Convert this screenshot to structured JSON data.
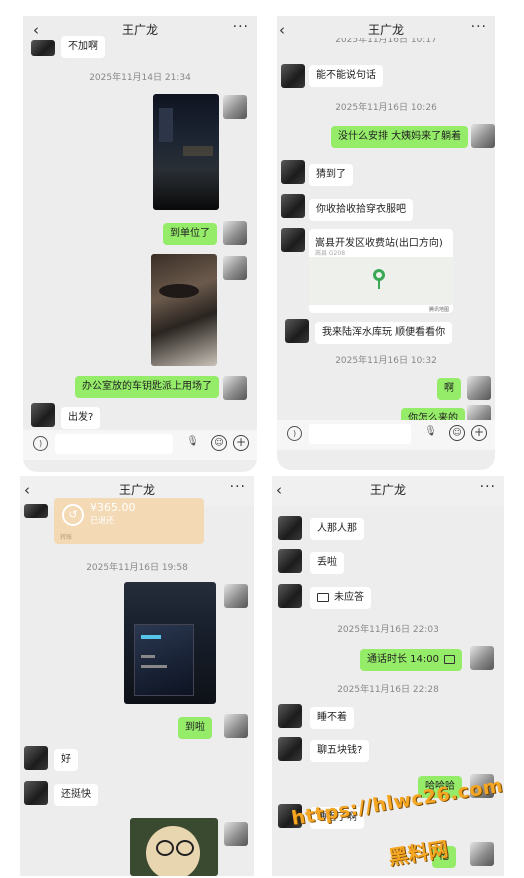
{
  "panel1": {
    "title": "王广龙",
    "back": "‹",
    "more": "···",
    "top_partial_msg": "不加啊",
    "timestamp1": "2025年11月14日 21:34",
    "msg_arrived": "到单位了",
    "msg_keys": "办公室放的车钥匙派上用场了",
    "msg_depart": "出发?"
  },
  "panel2": {
    "title": "王广龙",
    "back": "‹",
    "more": "···",
    "top_partial_ts": "2025年11月16日 10:17",
    "msg_talk": "能不能说句话",
    "timestamp1": "2025年11月16日 10:26",
    "msg_arrange": "没什么安排 大姨妈来了躺着",
    "msg_guess": "猜到了",
    "msg_clothes": "你收拾收拾穿衣服吧",
    "location_title": "嵩县开发区收费站(出口方向)",
    "location_sub": "嵩县 G208",
    "location_brand": "腾讯地图",
    "msg_reservoir": "我来陆浑水库玩 顺便看看你",
    "timestamp2": "2025年11月16日 10:32",
    "msg_ah": "啊",
    "msg_how": "你怎么来的"
  },
  "panel3": {
    "title": "王广龙",
    "back": "‹",
    "more": "···",
    "transfer_amount": "¥365.00",
    "transfer_status": "已退还",
    "transfer_label": "转账",
    "timestamp1": "2025年11月16日 19:58",
    "msg_arrived": "到啦",
    "msg_ok": "好",
    "msg_fast": "还挺快"
  },
  "panel4": {
    "title": "王广龙",
    "back": "‹",
    "more": "···",
    "msg_people": "人那人那",
    "msg_lost": "丢啦",
    "msg_missed": "未应答",
    "timestamp1": "2025年11月16日 22:03",
    "msg_call": "通话时长 14:00",
    "timestamp2": "2025年11月16日 22:28",
    "msg_nosleep": "睡不着",
    "msg_chat": "聊五块钱?",
    "msg_haha": "哈哈哈",
    "msg_asleep": "睡着了啊",
    "msg_partial": "他"
  },
  "watermark": {
    "url": "https://hlwc26.com",
    "name": "黑料网"
  },
  "colors": {
    "chat_bg": "#ededed",
    "out_bubble": "#95ec69",
    "in_bubble": "#ffffff",
    "watermark": "#f5a623"
  }
}
